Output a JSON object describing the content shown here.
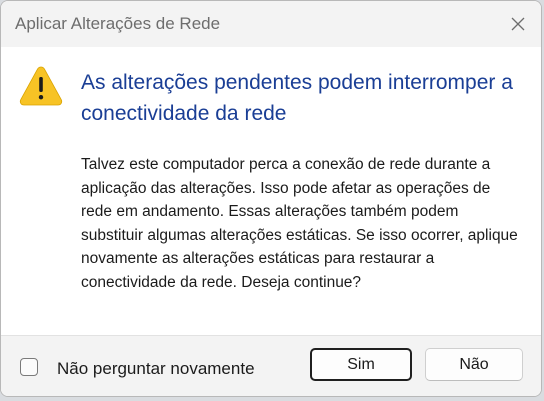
{
  "window": {
    "title": "Aplicar Alterações de Rede"
  },
  "dialog": {
    "icon": "warning-triangle-icon",
    "heading": "As alterações pendentes podem interromper a conectividade da rede",
    "message": "Talvez este computador perca a conexão de rede durante a aplicação das alterações. Isso pode afetar as operações de rede em andamento. Essas alterações também podem substituir algumas alterações estáticas. Se isso ocorrer, aplique novamente as alterações estáticas para restaurar a conectividade da rede. Deseja continue?"
  },
  "footer": {
    "checkbox_label": "Não perguntar novamente",
    "checkbox_checked": false,
    "yes_label": "Sim",
    "no_label": "Não"
  },
  "colors": {
    "heading": "#1a3e95",
    "warning_fill": "#f7c325",
    "titlebar": "#f3f3f3"
  }
}
